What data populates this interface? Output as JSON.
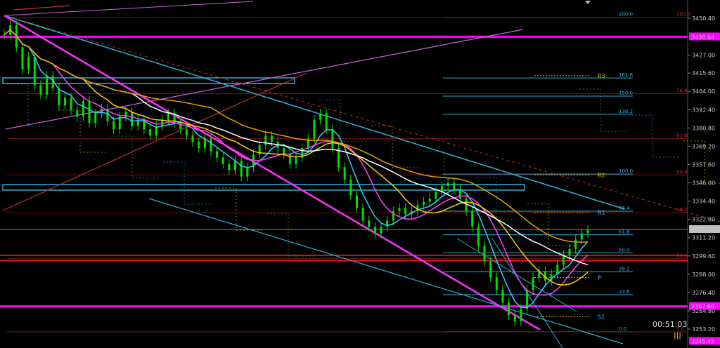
{
  "chart_data": {
    "type": "candlestick",
    "price_axis": {
      "ylim": [
        3245,
        3455
      ],
      "ticks": [
        3450.4,
        3427.0,
        3415.6,
        3404.0,
        3392.4,
        3380.8,
        3369.2,
        3357.6,
        3346.0,
        3334.4,
        3322.8,
        3311.2,
        3299.6,
        3288.0,
        3276.4,
        3264.8,
        3253.2
      ],
      "tick_labels": [
        "3450.40",
        "3427.00",
        "3415.60",
        "3404.00",
        "3392.40",
        "3380.80",
        "3369.20",
        "3357.60",
        "3346.00",
        "3334.40",
        "3322.80",
        "3311.20",
        "3299.60",
        "3288.00",
        "3276.40",
        "3264.80",
        "3253.20"
      ],
      "current_price_label": "3316.40",
      "magenta_label_top": "3438.64",
      "magenta_label_mid": "3267.60",
      "magenta_label_bottom": "3245.45"
    },
    "current_price": 3316.4,
    "horizontal_levels": [
      {
        "price": 3438.64,
        "color": "#ff00ff",
        "label": "3438.64"
      },
      {
        "price": 3267.6,
        "color": "#ff00ff",
        "label": "3267.60"
      },
      {
        "price": 3300.0,
        "color": "#ff2020"
      },
      {
        "price": 3296.5,
        "color": "#ff2020"
      }
    ],
    "fib_blue": [
      {
        "level": "200.0",
        "price": 3451.0
      },
      {
        "level": "161.8",
        "price": 3412.5
      },
      {
        "level": "150.0",
        "price": 3401.0
      },
      {
        "level": "138.2",
        "price": 3389.5
      },
      {
        "level": "100.0",
        "price": 3351.5
      },
      {
        "level": "76.4",
        "price": 3328.0
      },
      {
        "level": "61.8",
        "price": 3313.0
      },
      {
        "level": "50.0",
        "price": 3301.5
      },
      {
        "level": "38.2",
        "price": 3289.5
      },
      {
        "level": "23.6",
        "price": 3275.0
      },
      {
        "level": "0.0",
        "price": 3251.5
      }
    ],
    "fib_red": [
      {
        "level": "100.0",
        "price": 3451.0
      },
      {
        "level": "76.4",
        "price": 3402.5
      },
      {
        "level": "61.8",
        "price": 3374.0
      },
      {
        "level": "50.0",
        "price": 3351.0
      },
      {
        "level": "38.2",
        "price": 3327.0
      },
      {
        "level": "23.6",
        "price": 3298.0
      },
      {
        "level": "0.0",
        "price": 3251.5
      }
    ],
    "pivots": [
      {
        "name": "R3",
        "price": 3414.0
      },
      {
        "name": "R2",
        "price": 3351.0
      },
      {
        "name": "R1",
        "price": 3327.0
      },
      {
        "name": "P",
        "price": 3286.0
      },
      {
        "name": "S1",
        "price": 3261.0
      }
    ],
    "close_series": [
      3440,
      3446,
      3432,
      3418,
      3426,
      3408,
      3402,
      3414,
      3406,
      3395,
      3400,
      3392,
      3388,
      3398,
      3384,
      3390,
      3393,
      3385,
      3380,
      3388,
      3391,
      3382,
      3386,
      3380,
      3376,
      3382,
      3386,
      3390,
      3384,
      3380,
      3376,
      3372,
      3368,
      3374,
      3366,
      3362,
      3358,
      3354,
      3360,
      3350,
      3356,
      3364,
      3370,
      3376,
      3372,
      3368,
      3364,
      3358,
      3362,
      3368,
      3374,
      3386,
      3390,
      3380,
      3368,
      3356,
      3348,
      3338,
      3330,
      3322,
      3318,
      3314,
      3318,
      3322,
      3328,
      3330,
      3326,
      3328,
      3332,
      3334,
      3336,
      3340,
      3344,
      3346,
      3342,
      3336,
      3328,
      3318,
      3306,
      3296,
      3286,
      3278,
      3270,
      3262,
      3258,
      3266,
      3278,
      3286,
      3290,
      3284,
      3288,
      3294,
      3300,
      3304,
      3310,
      3314,
      3316
    ]
  },
  "overlay": {
    "timer": "00:51:03",
    "marker": "|||"
  }
}
